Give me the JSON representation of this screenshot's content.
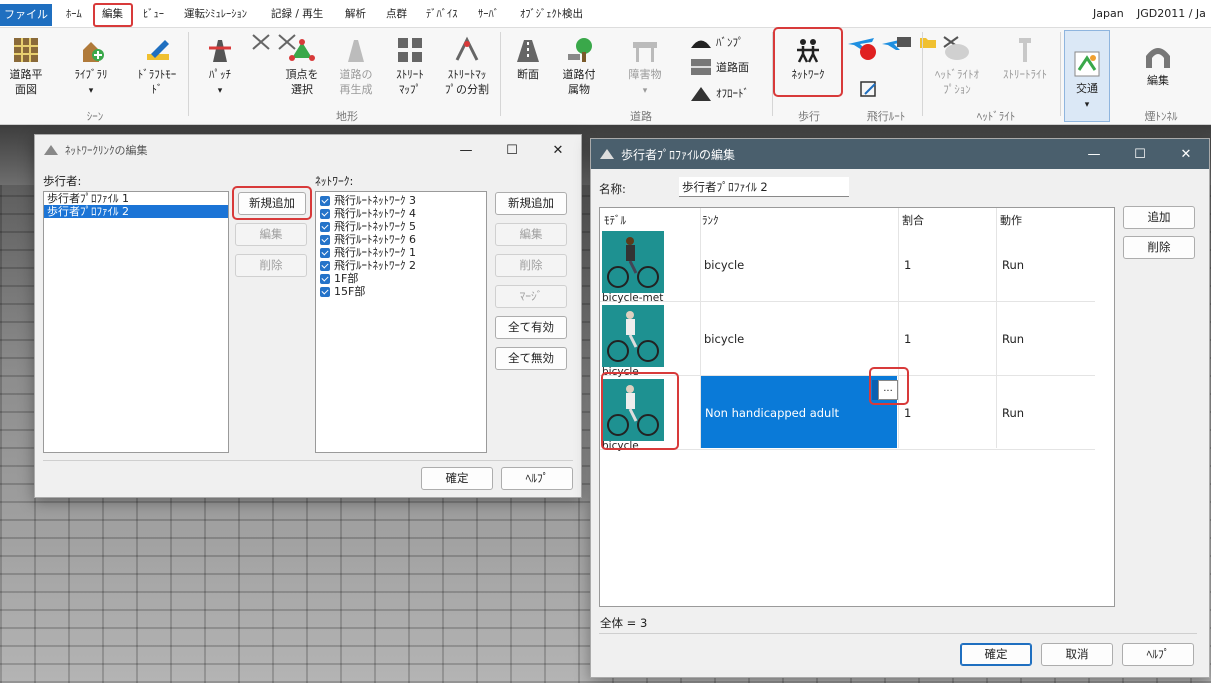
{
  "menubar": {
    "file": "ファイル",
    "items": [
      "ﾎｰﾑ",
      "編集",
      "ﾋﾞｭｰ",
      "運転ｼﾐｭﾚｰｼｮﾝ",
      "記録 / 再生",
      "解析",
      "点群",
      "ﾃﾞﾊﾞｲｽ",
      "ｻｰﾊﾞ",
      "ｵﾌﾞｼﾞｪｸﾄ検出"
    ],
    "right_country": "Japan",
    "right_crs": "JGD2011 / Ja"
  },
  "ribbon": {
    "road_plan": "道路平\n面図",
    "library": "ﾗｲﾌﾞﾗﾘ",
    "draft_mode": "ﾄﾞﾗﾌﾄﾓｰ\nﾄﾞ",
    "patch": "ﾊﾟｯﾁ",
    "select_vertex": "頂点を\n選択",
    "road_regen": "道路の\n再生成",
    "street_map": "ｽﾄﾘｰﾄ\nﾏｯﾌﾟ",
    "street_split": "ｽﾄﾘｰﾄﾏｯ\nﾌﾟの分割",
    "cross_section": "断面",
    "road_attach": "道路付\n属物",
    "obstacle": "障害物",
    "bump": "ﾊﾞﾝﾌﾟ",
    "road_surface": "道路面",
    "offroad": "ｵﾌﾛｰﾄﾞ",
    "network": "ﾈｯﾄﾜｰｸ",
    "headlight_option": "ﾍｯﾄﾞﾗｲﾄｵ\nﾌﾟｼｮﾝ",
    "street_light": "ｽﾄﾘｰﾄﾗｲﾄ",
    "traffic": "交通",
    "edit": "編集",
    "groups": {
      "scene": "ｼｰﾝ",
      "terrain": "地形",
      "road": "道路",
      "walk": "歩行",
      "flight": "飛行ﾙｰﾄ",
      "headlight": "ﾍｯﾄﾞﾗｲﾄ",
      "tunnel": "煙ﾄﾝﾈﾙ"
    }
  },
  "network_dialog": {
    "title": "ﾈｯﾄﾜｰｸﾘﾝｸの編集",
    "pedestrians_label": "歩行者:",
    "pedestrians": [
      "歩行者ﾌﾟﾛﾌｧｲﾙ 1",
      "歩行者ﾌﾟﾛﾌｧｲﾙ 2"
    ],
    "network_label": "ﾈｯﾄﾜｰｸ:",
    "networks": [
      "飛行ﾙｰﾄﾈｯﾄﾜｰｸ 3",
      "飛行ﾙｰﾄﾈｯﾄﾜｰｸ 4",
      "飛行ﾙｰﾄﾈｯﾄﾜｰｸ 5",
      "飛行ﾙｰﾄﾈｯﾄﾜｰｸ 6",
      "飛行ﾙｰﾄﾈｯﾄﾜｰｸ 1",
      "飛行ﾙｰﾄﾈｯﾄﾜｰｸ 2",
      "1F部",
      "15F部"
    ],
    "btn_new": "新規追加",
    "btn_edit": "編集",
    "btn_delete": "削除",
    "btn_new2": "新規追加",
    "btn_edit2": "編集",
    "btn_delete2": "削除",
    "btn_merge": "ﾏｰｼﾞ",
    "btn_all_on": "全て有効",
    "btn_all_off": "全て無効",
    "btn_ok": "確定",
    "btn_help": "ﾍﾙﾌﾟ"
  },
  "profile_dialog": {
    "title": "歩行者ﾌﾟﾛﾌｧｲﾙの編集",
    "name_label": "名称:",
    "name_value": "歩行者ﾌﾟﾛﾌｧｲﾙ 2",
    "columns": [
      "ﾓﾃﾞﾙ",
      "ﾗﾝｸ",
      "割合",
      "動作"
    ],
    "rows": [
      {
        "model": "bicycle-met",
        "rank": "bicycle",
        "ratio": "1",
        "action": "Run"
      },
      {
        "model": "bicycle",
        "rank": "bicycle",
        "ratio": "1",
        "action": "Run"
      },
      {
        "model": "bicycle",
        "rank": "Non handicapped adult",
        "ratio": "1",
        "action": "Run"
      }
    ],
    "ellipsis": "...",
    "btn_add": "追加",
    "btn_delete": "削除",
    "total": "全体 = 3",
    "btn_ok": "確定",
    "btn_cancel": "取消",
    "btn_help": "ﾍﾙﾌﾟ"
  },
  "colors": {
    "accent": "#1f6fc0",
    "highlight_red": "#d83a3a",
    "profile_title_bar": "#4a5f6d",
    "selection": "#1b74d6"
  }
}
